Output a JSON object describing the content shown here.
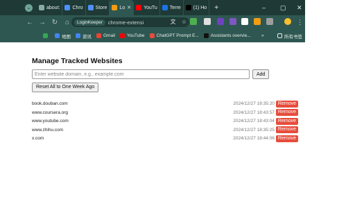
{
  "browser": {
    "tabs": [
      {
        "label": "about:",
        "icon": "globe-icon",
        "color": "#8aa"
      },
      {
        "label": "Chro",
        "icon": "puzzle-icon",
        "color": "#4d90fe"
      },
      {
        "label": "Store",
        "icon": "store-icon",
        "color": "#4d90fe"
      },
      {
        "label": "Lo",
        "icon": "loginkeeper-icon",
        "color": "#f39c12",
        "active": true
      },
      {
        "label": "YouTu",
        "icon": "youtube-icon",
        "color": "#ff0000"
      },
      {
        "label": "Terre",
        "icon": "c-icon",
        "color": "#1a73e8"
      },
      {
        "label": "(1) Ho",
        "icon": "x-icon",
        "color": "#000000"
      }
    ],
    "address": {
      "chip_label": "LoginKeeper",
      "url": "chrome-extensi"
    },
    "bookmarks": [
      {
        "label": "",
        "icon": "maps-pin-icon",
        "color": "#34a853"
      },
      {
        "label": "地图",
        "icon": "map-icon",
        "color": "#4285f4"
      },
      {
        "label": "资讯",
        "icon": "news-icon",
        "color": "#4285f4"
      },
      {
        "label": "Gmail",
        "icon": "gmail-icon",
        "color": "#ea4335"
      },
      {
        "label": "YouTube",
        "icon": "youtube-icon",
        "color": "#ff0000"
      },
      {
        "label": "ChatGPT Prompt E...",
        "icon": "chatgpt-icon",
        "color": "#e74c3c"
      },
      {
        "label": "Assistants overvie...",
        "icon": "openai-icon",
        "color": "#111111"
      }
    ],
    "all_bookmarks": "所有书签",
    "more": "»"
  },
  "page": {
    "title": "Manage Tracked Websites",
    "input_placeholder": "Enter website domain, e.g., example.com",
    "add_label": "Add",
    "reset_label": "Reset All to One Week Ago",
    "remove_label": "Remove",
    "remove_color": "#e74c3c",
    "sites": [
      {
        "domain": "book.douban.com",
        "time": "2024/12/27 18:35:20"
      },
      {
        "domain": "www.coursera.org",
        "time": "2024/12/27 18:43:57"
      },
      {
        "domain": "www.youtube.com",
        "time": "2024/12/27 18:43:04"
      },
      {
        "domain": "www.zhihu.com",
        "time": "2024/12/27 18:35:25"
      },
      {
        "domain": "x.com",
        "time": "2024/12/27 18:44:06"
      }
    ]
  }
}
